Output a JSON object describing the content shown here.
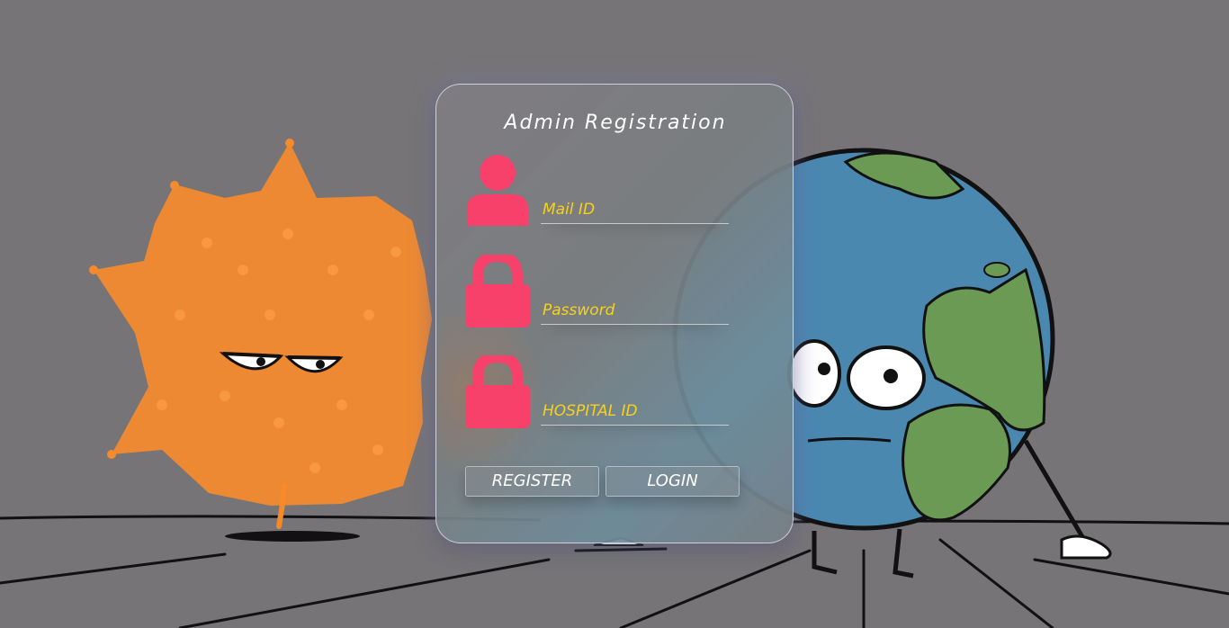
{
  "form": {
    "title": "Admin Registration",
    "fields": [
      {
        "icon": "user-icon",
        "placeholder": "Mail ID",
        "value": ""
      },
      {
        "icon": "lock-icon",
        "placeholder": "Password",
        "value": ""
      },
      {
        "icon": "lock-icon",
        "placeholder": "HOSPITAL ID",
        "value": ""
      }
    ],
    "buttons": {
      "register_label": "REGISTER",
      "login_label": "LOGIN"
    }
  },
  "colors": {
    "background": "#767476",
    "icon": "#f7406a",
    "placeholder_text": "#f6d21b",
    "title_text": "#ffffff"
  },
  "background_art": {
    "characters": [
      "orange-virus-character",
      "earth-character"
    ]
  }
}
